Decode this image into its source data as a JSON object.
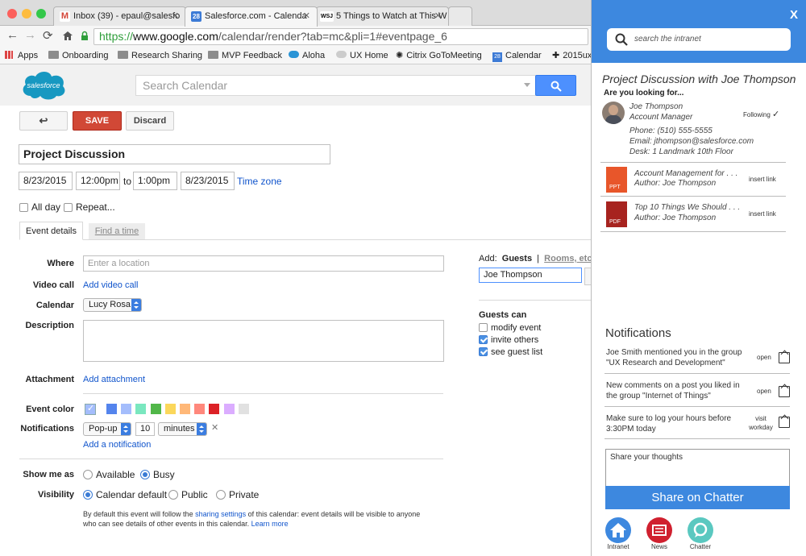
{
  "browser": {
    "tabs": [
      {
        "label": "Inbox (39) - epaul@salesfo",
        "favicon": "M"
      },
      {
        "label": "Salesforce.com - Calenda",
        "favicon": "28"
      },
      {
        "label": "5 Things to Watch at This W",
        "favicon": "WSJ"
      }
    ],
    "url_scheme": "https://",
    "url_host": "www.google.com",
    "url_path": "/calendar/render?tab=mc&pli=1#eventpage_6",
    "bookmarks": [
      "Apps",
      "Onboarding",
      "Research Sharing",
      "MVP Feedback",
      "Aloha",
      "UX Home",
      "Citrix GoToMeeting",
      "Calendar",
      "2015ux"
    ]
  },
  "header": {
    "logo_text": "salesforce",
    "search_placeholder": "Search Calendar"
  },
  "toolbar": {
    "back_label": "↩",
    "save_label": "SAVE",
    "discard_label": "Discard"
  },
  "event": {
    "title": "Project Discussion",
    "start_date": "8/23/2015",
    "start_time": "12:00pm",
    "to_label": "to",
    "end_time": "1:00pm",
    "end_date": "8/23/2015",
    "timezone_label": "Time zone",
    "allday_label": "All day",
    "repeat_label": "Repeat..."
  },
  "tabs": {
    "details": "Event details",
    "find_time": "Find a time"
  },
  "form": {
    "where_label": "Where",
    "where_placeholder": "Enter a location",
    "videocall_label": "Video call",
    "videocall_link": "Add video call",
    "calendar_label": "Calendar",
    "calendar_value": "Lucy Rosa",
    "description_label": "Description",
    "attachment_label": "Attachment",
    "attachment_link": "Add attachment",
    "eventcolor_label": "Event color",
    "notifications_label": "Notifications",
    "notif_type": "Pop-up",
    "notif_amount": "10",
    "notif_unit": "minutes",
    "notif_remove": "✕",
    "add_notification": "Add a notification",
    "showme_label": "Show me as",
    "available_label": "Available",
    "busy_label": "Busy",
    "visibility_label": "Visibility",
    "vis_default": "Calendar default",
    "vis_public": "Public",
    "vis_private": "Private",
    "footnote_a": "By default this event will follow the ",
    "footnote_link": "sharing settings",
    "footnote_b": " of this calendar: event details will be visible to anyone",
    "footnote_c": "who can see details of other events in this calendar. ",
    "learn_more": "Learn more"
  },
  "colors": [
    "#a4bdfc",
    "#5484ed",
    "#a4bdfc",
    "#7ae7bf",
    "#51b749",
    "#fbd75b",
    "#ffb878",
    "#ff887c",
    "#dc2127",
    "#dbadff",
    "#e1e1e1"
  ],
  "guests": {
    "add_label": "Add:",
    "guests_tab": "Guests",
    "rooms_tab": "Rooms, etc",
    "input_value": "Joe Thompson",
    "can_label": "Guests can",
    "perm_modify": "modify event",
    "perm_invite": "invite others",
    "perm_see": "see guest list"
  },
  "panel": {
    "close": "X",
    "search_placeholder": "search the intranet",
    "heading": "Project Discussion with Joe Thompson",
    "looking_for": "Are you looking for...",
    "person_name": "Joe Thompson",
    "person_title": "Account Manager",
    "following": "Following",
    "phone": "Phone: (510) 555-5555",
    "email": "Email: jthompson@salesforce.com",
    "desk": "Desk: 1 Landmark 10th Floor",
    "docs": [
      {
        "type": "PPT",
        "title": "Account Management for . . .",
        "author": "Author: Joe Thompson",
        "action": "insert link"
      },
      {
        "type": "PDF",
        "title": "Top 10 Things We Should . . .",
        "author": "Author: Joe Thompson",
        "action": "insert link"
      }
    ],
    "notifications_heading": "Notifications",
    "notifications": [
      {
        "line1": "Joe Smith mentioned you in the group",
        "line2": "\"UX Research and Development\"",
        "action1": "open",
        "action2": ""
      },
      {
        "line1": "New comments on a post you liked in",
        "line2": "the group \"Internet of Things\"",
        "action1": "open",
        "action2": ""
      },
      {
        "line1": "Make sure to log your hours before",
        "line2": "3:30PM today",
        "action1": "visit",
        "action2": "workday"
      }
    ],
    "share_placeholder": "Share your thoughts",
    "share_button": "Share on Chatter",
    "bottom_icons": [
      "Intranet",
      "News",
      "Chatter"
    ]
  }
}
